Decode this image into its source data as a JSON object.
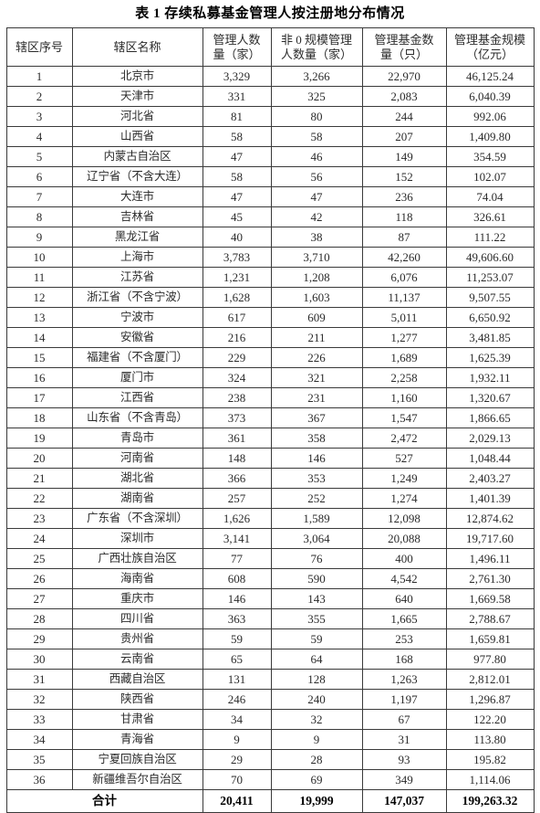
{
  "title": "表 1  存续私募基金管理人按注册地分布情况",
  "columns": [
    "辖区序号",
    "辖区名称",
    "管理人数量（家）",
    "非 0 规模管理人数量（家）",
    "管理基金数量（只）",
    "管理基金规模（亿元）"
  ],
  "column_lines": [
    [
      "辖区序号"
    ],
    [
      "辖区名称"
    ],
    [
      "管理人数",
      "量（家）"
    ],
    [
      "非 0 规模管理",
      "人数量（家）"
    ],
    [
      "管理基金数",
      "量（只）"
    ],
    [
      "管理基金规模",
      "（亿元）"
    ]
  ],
  "rows": [
    {
      "index": "1",
      "name": "北京市",
      "managers": "3,329",
      "nonzero": "3,266",
      "funds": "22,970",
      "scale": "46,125.24"
    },
    {
      "index": "2",
      "name": "天津市",
      "managers": "331",
      "nonzero": "325",
      "funds": "2,083",
      "scale": "6,040.39"
    },
    {
      "index": "3",
      "name": "河北省",
      "managers": "81",
      "nonzero": "80",
      "funds": "244",
      "scale": "992.06"
    },
    {
      "index": "4",
      "name": "山西省",
      "managers": "58",
      "nonzero": "58",
      "funds": "207",
      "scale": "1,409.80"
    },
    {
      "index": "5",
      "name": "内蒙古自治区",
      "managers": "47",
      "nonzero": "46",
      "funds": "149",
      "scale": "354.59"
    },
    {
      "index": "6",
      "name": "辽宁省（不含大连）",
      "managers": "58",
      "nonzero": "56",
      "funds": "152",
      "scale": "102.07"
    },
    {
      "index": "7",
      "name": "大连市",
      "managers": "47",
      "nonzero": "47",
      "funds": "236",
      "scale": "74.04"
    },
    {
      "index": "8",
      "name": "吉林省",
      "managers": "45",
      "nonzero": "42",
      "funds": "118",
      "scale": "326.61"
    },
    {
      "index": "9",
      "name": "黑龙江省",
      "managers": "40",
      "nonzero": "38",
      "funds": "87",
      "scale": "111.22"
    },
    {
      "index": "10",
      "name": "上海市",
      "managers": "3,783",
      "nonzero": "3,710",
      "funds": "42,260",
      "scale": "49,606.60"
    },
    {
      "index": "11",
      "name": "江苏省",
      "managers": "1,231",
      "nonzero": "1,208",
      "funds": "6,076",
      "scale": "11,253.07"
    },
    {
      "index": "12",
      "name": "浙江省（不含宁波）",
      "managers": "1,628",
      "nonzero": "1,603",
      "funds": "11,137",
      "scale": "9,507.55"
    },
    {
      "index": "13",
      "name": "宁波市",
      "managers": "617",
      "nonzero": "609",
      "funds": "5,011",
      "scale": "6,650.92"
    },
    {
      "index": "14",
      "name": "安徽省",
      "managers": "216",
      "nonzero": "211",
      "funds": "1,277",
      "scale": "3,481.85"
    },
    {
      "index": "15",
      "name": "福建省（不含厦门）",
      "managers": "229",
      "nonzero": "226",
      "funds": "1,689",
      "scale": "1,625.39"
    },
    {
      "index": "16",
      "name": "厦门市",
      "managers": "324",
      "nonzero": "321",
      "funds": "2,258",
      "scale": "1,932.11"
    },
    {
      "index": "17",
      "name": "江西省",
      "managers": "238",
      "nonzero": "231",
      "funds": "1,160",
      "scale": "1,320.67"
    },
    {
      "index": "18",
      "name": "山东省（不含青岛）",
      "managers": "373",
      "nonzero": "367",
      "funds": "1,547",
      "scale": "1,866.65"
    },
    {
      "index": "19",
      "name": "青岛市",
      "managers": "361",
      "nonzero": "358",
      "funds": "2,472",
      "scale": "2,029.13"
    },
    {
      "index": "20",
      "name": "河南省",
      "managers": "148",
      "nonzero": "146",
      "funds": "527",
      "scale": "1,048.44"
    },
    {
      "index": "21",
      "name": "湖北省",
      "managers": "366",
      "nonzero": "353",
      "funds": "1,249",
      "scale": "2,403.27"
    },
    {
      "index": "22",
      "name": "湖南省",
      "managers": "257",
      "nonzero": "252",
      "funds": "1,274",
      "scale": "1,401.39"
    },
    {
      "index": "23",
      "name": "广东省（不含深圳）",
      "managers": "1,626",
      "nonzero": "1,589",
      "funds": "12,098",
      "scale": "12,874.62"
    },
    {
      "index": "24",
      "name": "深圳市",
      "managers": "3,141",
      "nonzero": "3,064",
      "funds": "20,088",
      "scale": "19,717.60"
    },
    {
      "index": "25",
      "name": "广西壮族自治区",
      "managers": "77",
      "nonzero": "76",
      "funds": "400",
      "scale": "1,496.11"
    },
    {
      "index": "26",
      "name": "海南省",
      "managers": "608",
      "nonzero": "590",
      "funds": "4,542",
      "scale": "2,761.30"
    },
    {
      "index": "27",
      "name": "重庆市",
      "managers": "146",
      "nonzero": "143",
      "funds": "640",
      "scale": "1,669.58"
    },
    {
      "index": "28",
      "name": "四川省",
      "managers": "363",
      "nonzero": "355",
      "funds": "1,665",
      "scale": "2,788.67"
    },
    {
      "index": "29",
      "name": "贵州省",
      "managers": "59",
      "nonzero": "59",
      "funds": "253",
      "scale": "1,659.81"
    },
    {
      "index": "30",
      "name": "云南省",
      "managers": "65",
      "nonzero": "64",
      "funds": "168",
      "scale": "977.80"
    },
    {
      "index": "31",
      "name": "西藏自治区",
      "managers": "131",
      "nonzero": "128",
      "funds": "1,263",
      "scale": "2,812.01"
    },
    {
      "index": "32",
      "name": "陕西省",
      "managers": "246",
      "nonzero": "240",
      "funds": "1,197",
      "scale": "1,296.87"
    },
    {
      "index": "33",
      "name": "甘肃省",
      "managers": "34",
      "nonzero": "32",
      "funds": "67",
      "scale": "122.20"
    },
    {
      "index": "34",
      "name": "青海省",
      "managers": "9",
      "nonzero": "9",
      "funds": "31",
      "scale": "113.80"
    },
    {
      "index": "35",
      "name": "宁夏回族自治区",
      "managers": "29",
      "nonzero": "28",
      "funds": "93",
      "scale": "195.82"
    },
    {
      "index": "36",
      "name": "新疆维吾尔自治区",
      "managers": "70",
      "nonzero": "69",
      "funds": "349",
      "scale": "1,114.06"
    }
  ],
  "total": {
    "label": "合计",
    "managers": "20,411",
    "nonzero": "19,999",
    "funds": "147,037",
    "scale": "199,263.32"
  },
  "colors": {
    "border": "#3a3a3a",
    "text": "#2b2b2b",
    "heading_text": "#000000",
    "background": "#ffffff"
  }
}
